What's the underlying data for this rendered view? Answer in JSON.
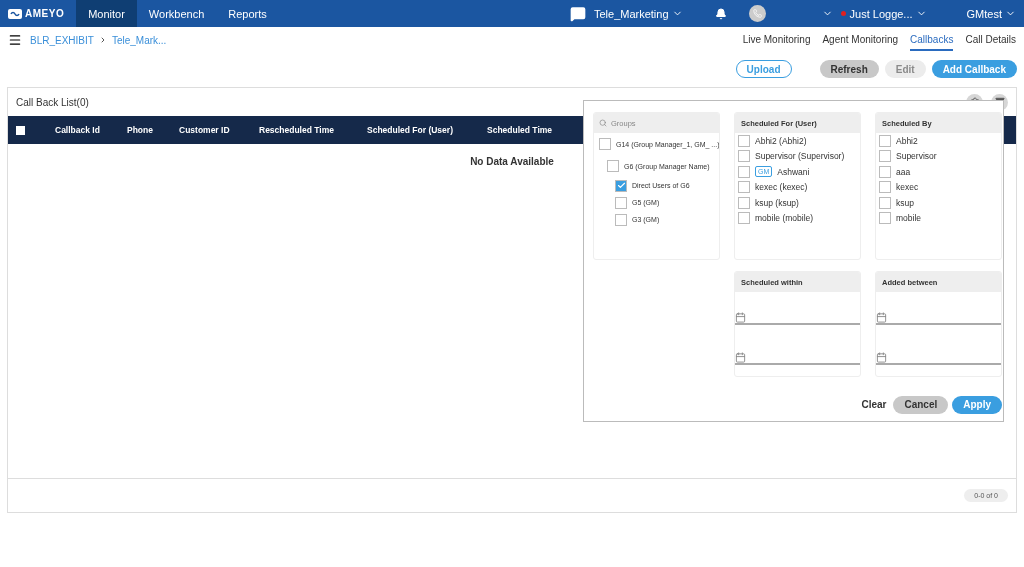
{
  "topbar": {
    "logo": "AMEYO",
    "nav": [
      {
        "label": "Monitor",
        "selected": true
      },
      {
        "label": "Workbench",
        "selected": false
      },
      {
        "label": "Reports",
        "selected": false
      }
    ],
    "campaign": "Tele_Marketing",
    "status": "Just Logge...",
    "user": "GMtest"
  },
  "breadcrumb": [
    "BLR_EXHIBIT",
    "Tele_Mark..."
  ],
  "tabs": [
    {
      "label": "Live Monitoring",
      "selected": false
    },
    {
      "label": "Agent Monitoring",
      "selected": false
    },
    {
      "label": "Callbacks",
      "selected": true
    },
    {
      "label": "Call Details",
      "selected": false
    }
  ],
  "actions": [
    {
      "label": "Upload",
      "kind": "outline",
      "disabled": false
    },
    {
      "label": "Refresh",
      "kind": "grey",
      "disabled": false
    },
    {
      "label": "Edit",
      "kind": "grey",
      "disabled": true
    },
    {
      "label": "Add Callback",
      "kind": "primary",
      "disabled": false
    }
  ],
  "card": {
    "title": "Call Back List(0)",
    "select_all": {
      "checked": false
    },
    "columns": [
      "Callback Id",
      "Phone",
      "Customer ID",
      "Rescheduled Time",
      "Scheduled For (User)",
      "Scheduled Time"
    ],
    "empty": "No Data Available",
    "pagination": "0-0 of 0"
  },
  "filter": {
    "groups": {
      "placeholder": "Groups",
      "tree": [
        {
          "label": "G14 (Group Manager_1, GM_ ...)",
          "checked": false,
          "children": [
            {
              "label": "G6 (Group Manager Name)",
              "checked": false,
              "children": [
                {
                  "label": "Direct Users of G6",
                  "checked": true
                },
                {
                  "label": "G5 (GM)",
                  "checked": false
                },
                {
                  "label": "G3 (GM)",
                  "checked": false
                }
              ]
            }
          ]
        }
      ]
    },
    "scheduled_for": {
      "title": "Scheduled For (User)",
      "items": [
        {
          "label": "Abhi2 (Abhi2)",
          "checked": false
        },
        {
          "label": "Supervisor (Supervisor)",
          "checked": false
        },
        {
          "label": "Ashwani",
          "badge": "GM",
          "checked": false
        },
        {
          "label": "kexec (kexec)",
          "checked": false
        },
        {
          "label": "ksup (ksup)",
          "checked": false
        },
        {
          "label": "mobile (mobile)",
          "checked": false
        }
      ]
    },
    "scheduled_by": {
      "title": "Scheduled By",
      "items": [
        {
          "label": "Abhi2",
          "checked": false
        },
        {
          "label": "Supervisor",
          "checked": false
        },
        {
          "label": "aaa",
          "checked": false
        },
        {
          "label": "kexec",
          "checked": false
        },
        {
          "label": "ksup",
          "checked": false
        },
        {
          "label": "mobile",
          "checked": false
        }
      ]
    },
    "scheduled_within": {
      "title": "Scheduled within"
    },
    "added_between": {
      "title": "Added between"
    },
    "buttons": [
      {
        "label": "Clear",
        "kind": "text"
      },
      {
        "label": "Cancel",
        "kind": "grey"
      },
      {
        "label": "Apply",
        "kind": "primary"
      }
    ]
  }
}
